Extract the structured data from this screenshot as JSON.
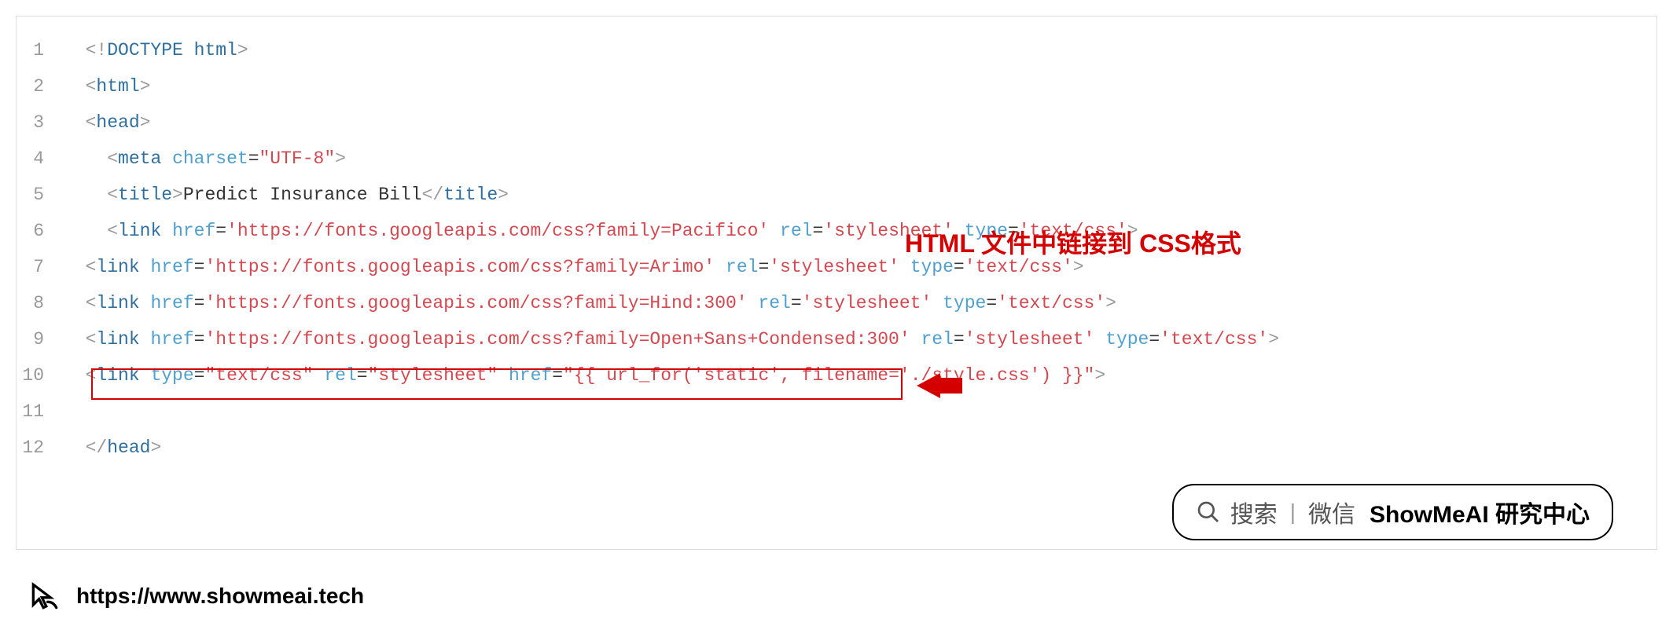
{
  "code": {
    "lines": [
      {
        "num": "1",
        "indent": "  ",
        "tokens": [
          {
            "t": "bracket",
            "v": "<!"
          },
          {
            "t": "tagname",
            "v": "DOCTYPE html"
          },
          {
            "t": "bracket",
            "v": ">"
          }
        ]
      },
      {
        "num": "2",
        "indent": "  ",
        "tokens": [
          {
            "t": "bracket",
            "v": "<"
          },
          {
            "t": "tagname",
            "v": "html"
          },
          {
            "t": "bracket",
            "v": ">"
          }
        ]
      },
      {
        "num": "3",
        "indent": "  ",
        "tokens": [
          {
            "t": "bracket",
            "v": "<"
          },
          {
            "t": "tagname",
            "v": "head"
          },
          {
            "t": "bracket",
            "v": ">"
          }
        ]
      },
      {
        "num": "4",
        "indent": "    ",
        "tokens": [
          {
            "t": "bracket",
            "v": "<"
          },
          {
            "t": "tagname",
            "v": "meta"
          },
          {
            "t": "text",
            "v": " "
          },
          {
            "t": "attrname",
            "v": "charset"
          },
          {
            "t": "text",
            "v": "="
          },
          {
            "t": "attrvalue",
            "v": "\"UTF-8\""
          },
          {
            "t": "bracket",
            "v": ">"
          }
        ]
      },
      {
        "num": "5",
        "indent": "    ",
        "tokens": [
          {
            "t": "bracket",
            "v": "<"
          },
          {
            "t": "tagname",
            "v": "title"
          },
          {
            "t": "bracket",
            "v": ">"
          },
          {
            "t": "text",
            "v": "Predict Insurance Bill"
          },
          {
            "t": "bracket",
            "v": "</"
          },
          {
            "t": "tagname",
            "v": "title"
          },
          {
            "t": "bracket",
            "v": ">"
          }
        ]
      },
      {
        "num": "6",
        "indent": "    ",
        "tokens": [
          {
            "t": "bracket",
            "v": "<"
          },
          {
            "t": "tagname",
            "v": "link"
          },
          {
            "t": "text",
            "v": " "
          },
          {
            "t": "attrname",
            "v": "href"
          },
          {
            "t": "text",
            "v": "="
          },
          {
            "t": "attrvalue",
            "v": "'https://fonts.googleapis.com/css?family=Pacifico'"
          },
          {
            "t": "text",
            "v": " "
          },
          {
            "t": "attrname",
            "v": "rel"
          },
          {
            "t": "text",
            "v": "="
          },
          {
            "t": "attrvalue",
            "v": "'stylesheet'"
          },
          {
            "t": "text",
            "v": " "
          },
          {
            "t": "attrname",
            "v": "type"
          },
          {
            "t": "text",
            "v": "="
          },
          {
            "t": "attrvalue",
            "v": "'text/css'"
          },
          {
            "t": "bracket",
            "v": ">"
          }
        ]
      },
      {
        "num": "7",
        "indent": "  ",
        "tokens": [
          {
            "t": "bracket",
            "v": "<"
          },
          {
            "t": "tagname",
            "v": "link"
          },
          {
            "t": "text",
            "v": " "
          },
          {
            "t": "attrname",
            "v": "href"
          },
          {
            "t": "text",
            "v": "="
          },
          {
            "t": "attrvalue",
            "v": "'https://fonts.googleapis.com/css?family=Arimo'"
          },
          {
            "t": "text",
            "v": " "
          },
          {
            "t": "attrname",
            "v": "rel"
          },
          {
            "t": "text",
            "v": "="
          },
          {
            "t": "attrvalue",
            "v": "'stylesheet'"
          },
          {
            "t": "text",
            "v": " "
          },
          {
            "t": "attrname",
            "v": "type"
          },
          {
            "t": "text",
            "v": "="
          },
          {
            "t": "attrvalue",
            "v": "'text/css'"
          },
          {
            "t": "bracket",
            "v": ">"
          }
        ]
      },
      {
        "num": "8",
        "indent": "  ",
        "tokens": [
          {
            "t": "bracket",
            "v": "<"
          },
          {
            "t": "tagname",
            "v": "link"
          },
          {
            "t": "text",
            "v": " "
          },
          {
            "t": "attrname",
            "v": "href"
          },
          {
            "t": "text",
            "v": "="
          },
          {
            "t": "attrvalue",
            "v": "'https://fonts.googleapis.com/css?family=Hind:300'"
          },
          {
            "t": "text",
            "v": " "
          },
          {
            "t": "attrname",
            "v": "rel"
          },
          {
            "t": "text",
            "v": "="
          },
          {
            "t": "attrvalue",
            "v": "'stylesheet'"
          },
          {
            "t": "text",
            "v": " "
          },
          {
            "t": "attrname",
            "v": "type"
          },
          {
            "t": "text",
            "v": "="
          },
          {
            "t": "attrvalue",
            "v": "'text/css'"
          },
          {
            "t": "bracket",
            "v": ">"
          }
        ]
      },
      {
        "num": "9",
        "indent": "  ",
        "tokens": [
          {
            "t": "bracket",
            "v": "<"
          },
          {
            "t": "tagname",
            "v": "link"
          },
          {
            "t": "text",
            "v": " "
          },
          {
            "t": "attrname",
            "v": "href"
          },
          {
            "t": "text",
            "v": "="
          },
          {
            "t": "attrvalue",
            "v": "'https://fonts.googleapis.com/css?family=Open+Sans+Condensed:300'"
          },
          {
            "t": "text",
            "v": " "
          },
          {
            "t": "attrname",
            "v": "rel"
          },
          {
            "t": "text",
            "v": "="
          },
          {
            "t": "attrvalue",
            "v": "'stylesheet'"
          },
          {
            "t": "text",
            "v": " "
          },
          {
            "t": "attrname",
            "v": "type"
          },
          {
            "t": "text",
            "v": "="
          },
          {
            "t": "attrvalue",
            "v": "'text/css'"
          },
          {
            "t": "bracket",
            "v": ">"
          }
        ]
      },
      {
        "num": "10",
        "indent": "  ",
        "tokens": [
          {
            "t": "bracket",
            "v": "<"
          },
          {
            "t": "tagname",
            "v": "link"
          },
          {
            "t": "text",
            "v": " "
          },
          {
            "t": "attrname",
            "v": "type"
          },
          {
            "t": "text",
            "v": "="
          },
          {
            "t": "attrvalue",
            "v": "\"text/css\""
          },
          {
            "t": "text",
            "v": " "
          },
          {
            "t": "attrname",
            "v": "rel"
          },
          {
            "t": "text",
            "v": "="
          },
          {
            "t": "attrvalue",
            "v": "\"stylesheet\""
          },
          {
            "t": "text",
            "v": " "
          },
          {
            "t": "attrname",
            "v": "href"
          },
          {
            "t": "text",
            "v": "="
          },
          {
            "t": "attrvalue",
            "v": "\"{{ url_for('static', filename='./style.css') }}\""
          },
          {
            "t": "bracket",
            "v": ">"
          }
        ]
      },
      {
        "num": "11",
        "indent": "",
        "tokens": []
      },
      {
        "num": "12",
        "indent": "  ",
        "tokens": [
          {
            "t": "bracket",
            "v": "</"
          },
          {
            "t": "tagname",
            "v": "head"
          },
          {
            "t": "bracket",
            "v": ">"
          }
        ]
      }
    ]
  },
  "annotation": "HTML 文件中链接到 CSS格式",
  "search": {
    "label1": "搜索",
    "label2": "微信",
    "bold": "ShowMeAI 研究中心"
  },
  "footer": {
    "url": "https://www.showmeai.tech"
  }
}
